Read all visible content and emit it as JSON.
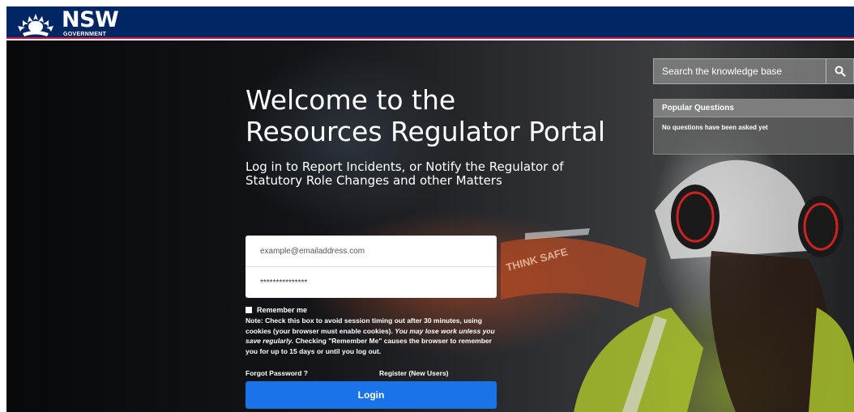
{
  "header": {
    "logo_text": "NSW",
    "logo_sub": "GOVERNMENT",
    "colors": {
      "navy": "#002664",
      "accent": "#d7153a"
    }
  },
  "hero": {
    "title_line1": "Welcome to the",
    "title_line2": "Resources Regulator Portal",
    "subtitle": "Log in to Report Incidents, or Notify the Regulator of Statutory Role Changes and other Matters"
  },
  "login_form": {
    "email_placeholder": "example@emailaddress.com",
    "password_value": "***************",
    "remember_label": "Remember me",
    "note_label": "Note:",
    "note_text1": " Check this box to avoid session timing out after 30 minutes, using cookies (your browser must enable cookies). ",
    "note_em": "You may lose work unless you save regularly.",
    "note_text2": " Checking \"Remember Me\" causes the browser to remember you for up to 15 days or until you log out.",
    "forgot_label": "Forgot Password ?",
    "register_label": "Register (New Users)",
    "login_label": "Login",
    "button_color": "#1a73e8"
  },
  "knowledge": {
    "search_placeholder": "Search the knowledge base",
    "search_icon": "magnifier-icon",
    "popular_title": "Popular Questions",
    "popular_empty": "No questions have been asked yet"
  }
}
